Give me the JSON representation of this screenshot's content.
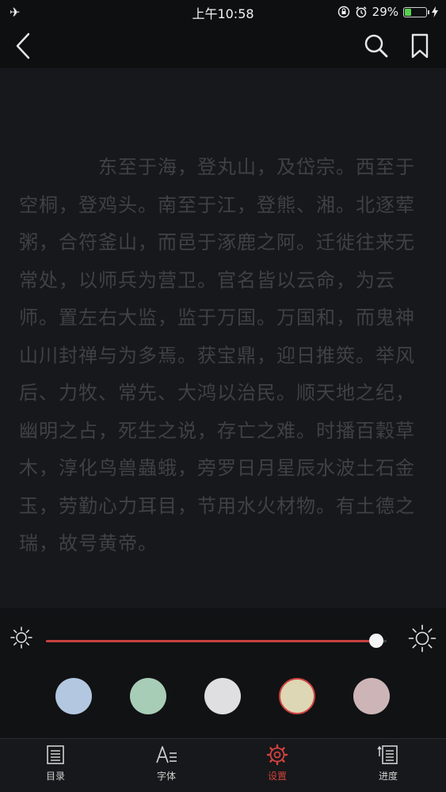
{
  "status_bar": {
    "time": "上午10:58",
    "battery_text": "29%",
    "battery_level": 0.29,
    "left_icon": "airplane-icon",
    "icons": [
      "rotation-lock-icon",
      "alarm-icon",
      "battery-icon",
      "charging-icon"
    ]
  },
  "nav": {
    "back_icon": "chevron-left-icon",
    "search_icon": "search-icon",
    "bookmark_icon": "bookmark-icon"
  },
  "content": {
    "paragraph": "东至于海，登丸山，及岱宗。西至于空桐，登鸡头。南至于江，登熊、湘。北逐荤粥，合符釜山，而邑于涿鹿之阿。迁徙往来无常处，以师兵为营卫。官名皆以云命，为云师。置左右大监，监于万国。万国和，而鬼神山川封禅与为多焉。获宝鼎，迎日推筴。举风后、力牧、常先、大鸿以治民。顺天地之纪，幽明之占，死生之说，存亡之难。时播百穀草木，淳化鸟兽蟲蛾，旁罗日月星辰水波土石金玉，劳勤心力耳目，节用水火材物。有土德之瑞，故号黄帝。"
  },
  "brightness": {
    "level": 0.97,
    "low_icon": "sun-small-icon",
    "high_icon": "sun-large-icon",
    "track_color": "#c8423e"
  },
  "themes": {
    "colors": [
      "#b3c7e0",
      "#a8cdb6",
      "#dfdfe1",
      "#ddd7b5",
      "#cdb5b7"
    ],
    "selected_index": 3,
    "selected_ring_color": "#d2423e"
  },
  "tabs": [
    {
      "label": "目录",
      "icon": "table-of-contents-icon",
      "active": false
    },
    {
      "label": "字体",
      "icon": "font-icon",
      "active": false
    },
    {
      "label": "设置",
      "icon": "settings-gear-icon",
      "active": true
    },
    {
      "label": "进度",
      "icon": "progress-icon",
      "active": false
    }
  ],
  "accent_color": "#d2423e"
}
